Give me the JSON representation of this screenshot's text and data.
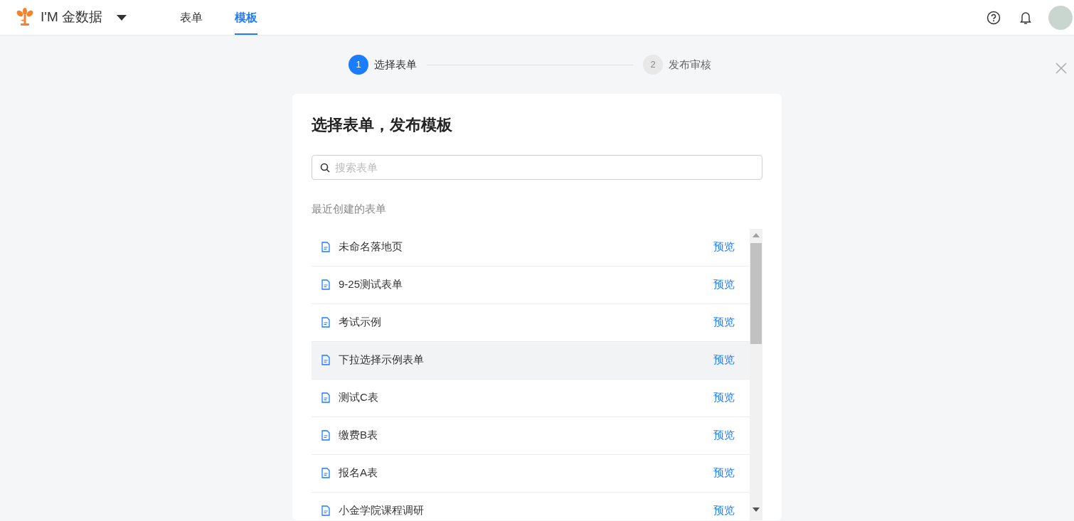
{
  "header": {
    "brand": "I'M 金数据",
    "nav": [
      {
        "label": "表单",
        "selected": false
      },
      {
        "label": "模板",
        "selected": true
      }
    ]
  },
  "steps": [
    {
      "number": "1",
      "label": "选择表单",
      "active": true
    },
    {
      "number": "2",
      "label": "发布审核",
      "active": false
    }
  ],
  "card": {
    "title": "选择表单，发布模板",
    "search": {
      "placeholder": "搜索表单"
    },
    "section_label": "最近创建的表单",
    "forms": [
      {
        "name": "未命名落地页",
        "action": "预览",
        "highlighted": false
      },
      {
        "name": "9-25测试表单",
        "action": "预览",
        "highlighted": false
      },
      {
        "name": "考试示例",
        "action": "预览",
        "highlighted": false
      },
      {
        "name": "下拉选择示例表单",
        "action": "预览",
        "highlighted": true
      },
      {
        "name": "测试C表",
        "action": "预览",
        "highlighted": false
      },
      {
        "name": "缴费B表",
        "action": "预览",
        "highlighted": false
      },
      {
        "name": "报名A表",
        "action": "预览",
        "highlighted": false
      },
      {
        "name": "小金学院课程调研",
        "action": "预览",
        "highlighted": false
      }
    ]
  }
}
